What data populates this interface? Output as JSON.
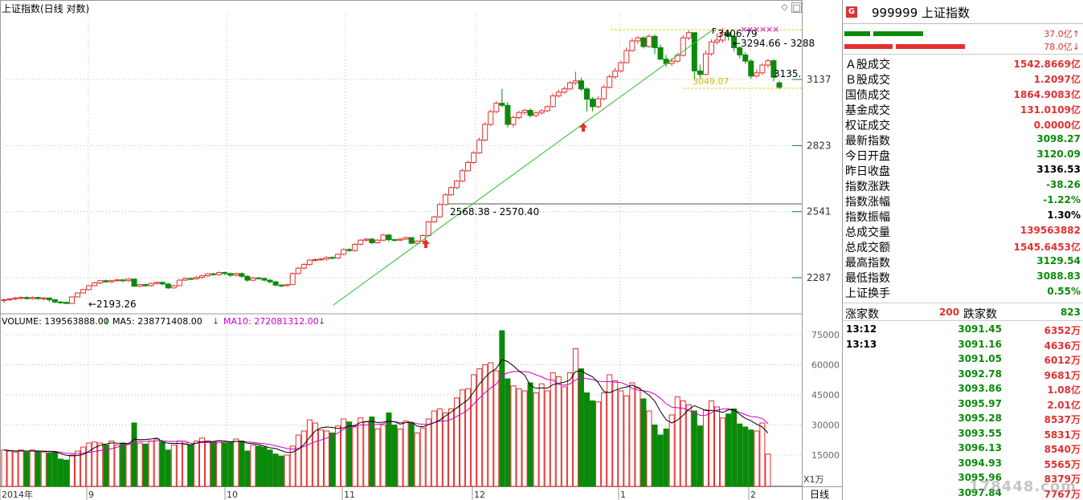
{
  "chart": {
    "title": "上证指数(日线 对数)",
    "volume_legend": {
      "volume": "VOLUME: 139563888.00",
      "ma5": "MA5: 238771408.00",
      "ma10": "MA10: 272081312.00",
      "arrow": "↓"
    },
    "price_axis_labels": [
      "3137",
      "2823",
      "2541",
      "2287"
    ],
    "volume_axis_labels": [
      "75000",
      "60000",
      "45000",
      "30000",
      "15000"
    ],
    "volume_unit_label": "X1万",
    "date_labels": [
      "2014年",
      "9",
      "10",
      "11",
      "12",
      "1",
      "2"
    ],
    "period_label": "日线",
    "annotations": {
      "low": "2193.26",
      "gap": "2568.38 - 2570.40",
      "high": "3406.79",
      "range": "3294.66 - 3288",
      "last": "3135.",
      "min": "3049.07"
    },
    "colors": {
      "up": "#e3302f",
      "down": "#0a8a0a",
      "ma5": "#000000",
      "ma10": "#cc00cc",
      "trend": "#2bbd2b",
      "level": "#e6d200"
    },
    "chart_data": {
      "type": "candlestick",
      "price_axis_ticks": [
        3137,
        2823,
        2541,
        2287
      ],
      "volume_axis_ticks": [
        75000,
        60000,
        45000,
        30000,
        15000
      ],
      "candles": [
        [
          2205,
          2208,
          2196,
          2212
        ],
        [
          2208,
          2211,
          2203,
          2214
        ],
        [
          2211,
          2214,
          2206,
          2218
        ],
        [
          2214,
          2216,
          2208,
          2220
        ],
        [
          2216,
          2212,
          2208,
          2220
        ],
        [
          2212,
          2216,
          2208,
          2220
        ],
        [
          2216,
          2212,
          2207,
          2219
        ],
        [
          2212,
          2214,
          2205,
          2217
        ],
        [
          2214,
          2208,
          2201,
          2216
        ],
        [
          2208,
          2200,
          2196,
          2211
        ],
        [
          2200,
          2199,
          2193,
          2203
        ],
        [
          2199,
          2195,
          2193,
          2201
        ],
        [
          2195,
          2218,
          2195,
          2220
        ],
        [
          2218,
          2232,
          2216,
          2234
        ],
        [
          2232,
          2244,
          2230,
          2247
        ],
        [
          2244,
          2258,
          2242,
          2260
        ],
        [
          2258,
          2268,
          2256,
          2272
        ],
        [
          2268,
          2276,
          2264,
          2279
        ],
        [
          2276,
          2272,
          2268,
          2280
        ],
        [
          2272,
          2276,
          2268,
          2279
        ],
        [
          2276,
          2279,
          2272,
          2283
        ],
        [
          2279,
          2276,
          2270,
          2282
        ],
        [
          2276,
          2282,
          2272,
          2285
        ],
        [
          2282,
          2256,
          2254,
          2284
        ],
        [
          2256,
          2262,
          2252,
          2265
        ],
        [
          2262,
          2258,
          2254,
          2266
        ],
        [
          2258,
          2266,
          2254,
          2269
        ],
        [
          2266,
          2270,
          2262,
          2273
        ],
        [
          2270,
          2264,
          2260,
          2274
        ],
        [
          2264,
          2250,
          2246,
          2268
        ],
        [
          2250,
          2258,
          2248,
          2262
        ],
        [
          2258,
          2278,
          2256,
          2282
        ],
        [
          2278,
          2284,
          2276,
          2288
        ],
        [
          2284,
          2283,
          2278,
          2288
        ],
        [
          2283,
          2288,
          2280,
          2292
        ],
        [
          2288,
          2294,
          2284,
          2297
        ],
        [
          2294,
          2301,
          2290,
          2304
        ],
        [
          2301,
          2298,
          2294,
          2305
        ],
        [
          2298,
          2306,
          2294,
          2310
        ],
        [
          2306,
          2302,
          2296,
          2309
        ],
        [
          2302,
          2296,
          2290,
          2306
        ],
        [
          2296,
          2302,
          2292,
          2305
        ],
        [
          2302,
          2292,
          2286,
          2306
        ],
        [
          2292,
          2278,
          2272,
          2296
        ],
        [
          2278,
          2286,
          2274,
          2290
        ],
        [
          2286,
          2284,
          2280,
          2290
        ],
        [
          2284,
          2278,
          2274,
          2288
        ],
        [
          2278,
          2272,
          2266,
          2282
        ],
        [
          2272,
          2260,
          2255,
          2276
        ],
        [
          2260,
          2258,
          2252,
          2264
        ],
        [
          2258,
          2262,
          2254,
          2264
        ],
        [
          2262,
          2302,
          2260,
          2306
        ],
        [
          2302,
          2322,
          2298,
          2326
        ],
        [
          2322,
          2336,
          2318,
          2340
        ],
        [
          2336,
          2352,
          2332,
          2356
        ],
        [
          2352,
          2354,
          2346,
          2358
        ],
        [
          2354,
          2356,
          2350,
          2360
        ],
        [
          2356,
          2362,
          2350,
          2366
        ],
        [
          2362,
          2360,
          2354,
          2366
        ],
        [
          2360,
          2374,
          2356,
          2377
        ],
        [
          2374,
          2392,
          2370,
          2396
        ],
        [
          2392,
          2388,
          2382,
          2397
        ],
        [
          2388,
          2412,
          2384,
          2416
        ],
        [
          2412,
          2428,
          2408,
          2432
        ],
        [
          2428,
          2432,
          2422,
          2436
        ],
        [
          2432,
          2418,
          2412,
          2436
        ],
        [
          2418,
          2428,
          2414,
          2432
        ],
        [
          2428,
          2448,
          2424,
          2452
        ],
        [
          2448,
          2430,
          2422,
          2452
        ],
        [
          2430,
          2428,
          2422,
          2434
        ],
        [
          2428,
          2432,
          2424,
          2436
        ],
        [
          2432,
          2438,
          2428,
          2442
        ],
        [
          2438,
          2416,
          2412,
          2440
        ],
        [
          2416,
          2424,
          2412,
          2428
        ],
        [
          2424,
          2446,
          2420,
          2450
        ],
        [
          2446,
          2500,
          2442,
          2504
        ],
        [
          2500,
          2520,
          2496,
          2524
        ],
        [
          2520,
          2570,
          2516,
          2578
        ],
        [
          2570,
          2610,
          2566,
          2616
        ],
        [
          2610,
          2640,
          2606,
          2646
        ],
        [
          2640,
          2668,
          2634,
          2672
        ],
        [
          2668,
          2712,
          2662,
          2720
        ],
        [
          2712,
          2748,
          2708,
          2756
        ],
        [
          2748,
          2790,
          2742,
          2800
        ],
        [
          2790,
          2848,
          2786,
          2860
        ],
        [
          2848,
          2920,
          2842,
          2930
        ],
        [
          2920,
          2980,
          2912,
          2990
        ],
        [
          2980,
          3020,
          2972,
          3030
        ],
        [
          3020,
          3010,
          3000,
          3090
        ],
        [
          3010,
          2920,
          2906,
          3026
        ],
        [
          2920,
          2952,
          2906,
          2962
        ],
        [
          2952,
          2976,
          2944,
          2984
        ],
        [
          2976,
          2986,
          2966,
          2994
        ],
        [
          2986,
          2962,
          2952,
          2996
        ],
        [
          2962,
          2974,
          2954,
          2982
        ],
        [
          2974,
          2984,
          2966,
          2992
        ],
        [
          2984,
          3004,
          2978,
          3010
        ],
        [
          3004,
          3056,
          3000,
          3068
        ],
        [
          3056,
          3074,
          3048,
          3086
        ],
        [
          3074,
          3090,
          3066,
          3102
        ],
        [
          3090,
          3120,
          3084,
          3130
        ],
        [
          3120,
          3130,
          3110,
          3176
        ],
        [
          3130,
          3090,
          3080,
          3146
        ],
        [
          3090,
          3040,
          2980,
          3098
        ],
        [
          3040,
          3004,
          2982,
          3050
        ],
        [
          3004,
          3042,
          2996,
          3054
        ],
        [
          3042,
          3098,
          3034,
          3110
        ],
        [
          3098,
          3150,
          3092,
          3162
        ],
        [
          3150,
          3180,
          3140,
          3196
        ],
        [
          3180,
          3222,
          3172,
          3232
        ],
        [
          3222,
          3285,
          3218,
          3300
        ],
        [
          3285,
          3336,
          3278,
          3350
        ],
        [
          3336,
          3352,
          3320,
          3360
        ],
        [
          3352,
          3306,
          3296,
          3362
        ],
        [
          3306,
          3360,
          3300,
          3370
        ],
        [
          3360,
          3300,
          3266,
          3370
        ],
        [
          3300,
          3240,
          3236,
          3316
        ],
        [
          3240,
          3218,
          3200,
          3262
        ],
        [
          3218,
          3230,
          3204,
          3246
        ],
        [
          3230,
          3260,
          3222,
          3272
        ],
        [
          3260,
          3352,
          3254,
          3366
        ],
        [
          3352,
          3380,
          3340,
          3392
        ],
        [
          3380,
          3180,
          3136,
          3382
        ],
        [
          3180,
          3162,
          3140,
          3212
        ],
        [
          3162,
          3268,
          3158,
          3286
        ],
        [
          3268,
          3330,
          3258,
          3344
        ],
        [
          3330,
          3340,
          3318,
          3376
        ],
        [
          3340,
          3380,
          3326,
          3406
        ],
        [
          3380,
          3360,
          3338,
          3392
        ],
        [
          3360,
          3300,
          3280,
          3368
        ],
        [
          3300,
          3262,
          3244,
          3308
        ],
        [
          3262,
          3230,
          3216,
          3276
        ],
        [
          3230,
          3154,
          3140,
          3240
        ],
        [
          3154,
          3170,
          3146,
          3188
        ],
        [
          3170,
          3210,
          3160,
          3220
        ],
        [
          3210,
          3232,
          3196,
          3240
        ],
        [
          3232,
          3148,
          3128,
          3242
        ],
        [
          3120,
          3098,
          3089,
          3130
        ]
      ],
      "volumes": [
        17500,
        17000,
        16500,
        17500,
        16500,
        17500,
        16800,
        16500,
        16000,
        16500,
        13000,
        12500,
        15000,
        17000,
        19000,
        21000,
        21500,
        21000,
        20000,
        22000,
        20000,
        21000,
        20500,
        31000,
        21000,
        20500,
        22000,
        23000,
        21500,
        17500,
        20000,
        22000,
        21000,
        20000,
        22000,
        23500,
        22000,
        21500,
        22000,
        21000,
        21500,
        23000,
        22000,
        17000,
        20000,
        19500,
        19000,
        17500,
        15500,
        14500,
        15000,
        19500,
        25000,
        27000,
        32500,
        31000,
        27500,
        27000,
        26000,
        29500,
        33000,
        31500,
        29000,
        33500,
        31500,
        34000,
        28000,
        30000,
        36000,
        30000,
        28000,
        32000,
        31000,
        26000,
        28500,
        33000,
        37000,
        38000,
        36000,
        38000,
        43500,
        47500,
        48000,
        55000,
        58000,
        60000,
        61000,
        57000,
        77000,
        53000,
        49500,
        48000,
        47000,
        51000,
        46000,
        50500,
        47000,
        56000,
        54000,
        49000,
        56000,
        68000,
        58000,
        46000,
        42000,
        41500,
        46000,
        55000,
        52000,
        47000,
        44500,
        51000,
        48500,
        43000,
        37000,
        30000,
        25000,
        28000,
        35000,
        44000,
        42000,
        40000,
        37000,
        29500,
        37500,
        42000,
        39000,
        33500,
        35500,
        38000,
        30500,
        29000,
        27500,
        27000,
        31000,
        15500
      ],
      "ma5_note": "volume MA5 / MA10 shown as black / magenta lines"
    }
  },
  "panel": {
    "code": "999999",
    "name": "上证指数",
    "badge": "G",
    "top_bars": {
      "green_val": "37.0亿↑",
      "red_val": "78.0亿↓"
    },
    "stats": [
      {
        "k": "Ａ股成交",
        "v": "1542.8669亿",
        "c": "red"
      },
      {
        "k": "Ｂ股成交",
        "v": "1.2097亿",
        "c": "red"
      },
      {
        "k": "国债成交",
        "v": "1864.9083亿",
        "c": "red"
      },
      {
        "k": "基金成交",
        "v": "131.0109亿",
        "c": "red"
      },
      {
        "k": "权证成交",
        "v": "0.0000亿",
        "c": "red"
      },
      {
        "k": "最新指数",
        "v": "3098.27",
        "c": "green"
      },
      {
        "k": "今日开盘",
        "v": "3120.09",
        "c": "green"
      },
      {
        "k": "昨日收盘",
        "v": "3136.53",
        "c": "blk"
      },
      {
        "k": "指数涨跌",
        "v": "-38.26",
        "c": "green"
      },
      {
        "k": "指数涨幅",
        "v": "-1.22%",
        "c": "green"
      },
      {
        "k": "指数振幅",
        "v": "1.30%",
        "c": "blk"
      },
      {
        "k": "总成交量",
        "v": "139563882",
        "c": "red"
      },
      {
        "k": "总成交额",
        "v": "1545.6453亿",
        "c": "red"
      },
      {
        "k": "最高指数",
        "v": "3129.54",
        "c": "green"
      },
      {
        "k": "最低指数",
        "v": "3088.83",
        "c": "green"
      },
      {
        "k": "上证换手",
        "v": "0.55%",
        "c": "green"
      }
    ],
    "updown": {
      "up_label": "涨家数",
      "up": "200",
      "down_label": "跌家数",
      "down": "823"
    },
    "ticks": [
      {
        "t": "13:12",
        "p": "3091.45",
        "vol": "6352万"
      },
      {
        "t": "13:13",
        "p": "3091.16",
        "vol": "4636万"
      },
      {
        "t": "",
        "p": "3091.05",
        "vol": "6012万"
      },
      {
        "t": "",
        "p": "3092.78",
        "vol": "9681万"
      },
      {
        "t": "",
        "p": "3093.86",
        "vol": "1.08亿"
      },
      {
        "t": "",
        "p": "3095.97",
        "vol": "2.01亿"
      },
      {
        "t": "",
        "p": "3095.28",
        "vol": "8537万"
      },
      {
        "t": "",
        "p": "3093.55",
        "vol": "5831万"
      },
      {
        "t": "",
        "p": "3096.13",
        "vol": "8540万"
      },
      {
        "t": "",
        "p": "3094.93",
        "vol": "5565万"
      },
      {
        "t": "",
        "p": "3095.96",
        "vol": "8379万"
      },
      {
        "t": "",
        "p": "3097.84",
        "vol": "7767万"
      }
    ],
    "watermark": "178448.com"
  }
}
